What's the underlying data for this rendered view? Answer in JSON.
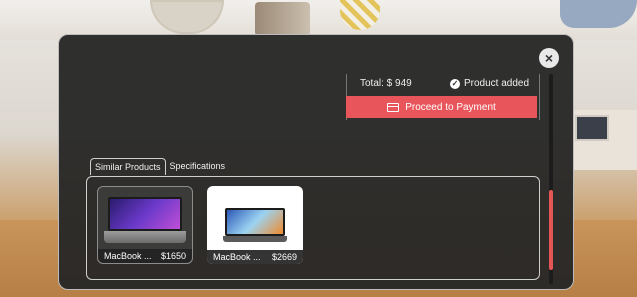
{
  "cart": {
    "total": "Total: $ 949",
    "added": "Product added",
    "pay_label": "Proceed to Payment"
  },
  "tabs": [
    {
      "label": "Similar Products",
      "active": true
    },
    {
      "label": "Specifications",
      "active": false
    }
  ],
  "products": [
    {
      "name": "MacBook ...",
      "price": "$1650"
    },
    {
      "name": "MacBook ...",
      "price": "$2669"
    }
  ],
  "close_icon": "×",
  "colors": {
    "accent": "#e8555b",
    "modal_bg": "#2a2a28"
  }
}
